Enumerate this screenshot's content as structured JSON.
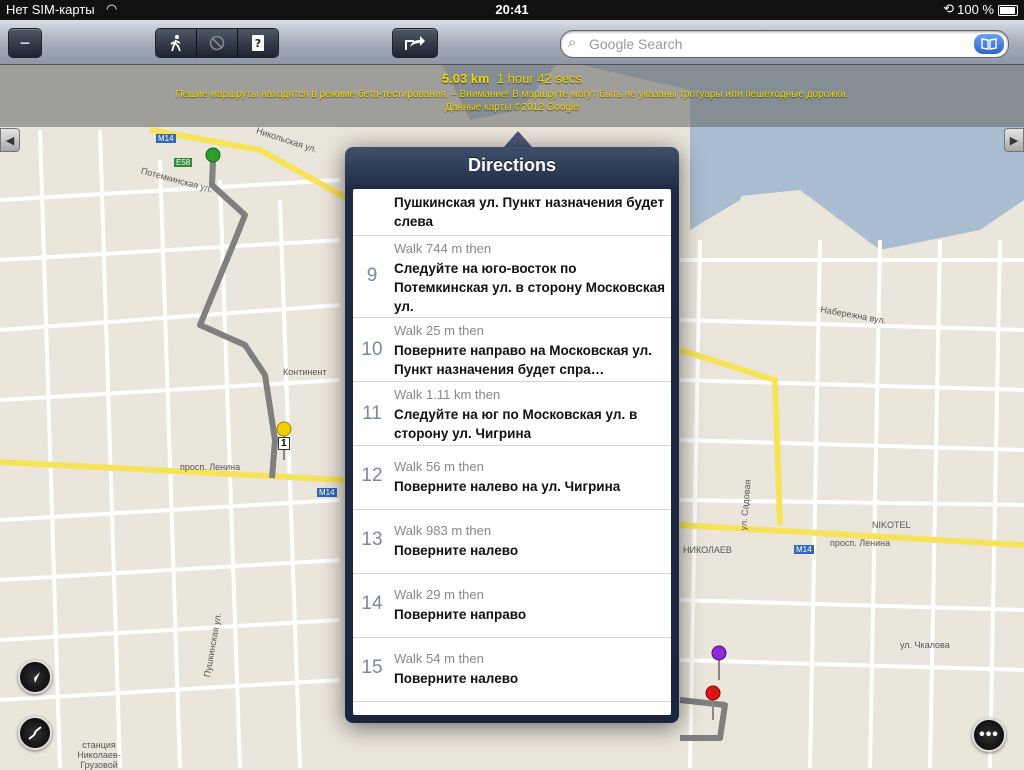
{
  "status_bar": {
    "carrier": "Нет SIM-карты",
    "time": "20:41",
    "battery": "100 %"
  },
  "toolbar": {
    "minus_label": "−",
    "search_placeholder": "Google Search",
    "icons": [
      "walk-icon",
      "no-entry-icon",
      "help-icon",
      "share-icon",
      "search-icon",
      "bookmarks-icon"
    ]
  },
  "route_info": {
    "distance": "5.03 km",
    "duration": "1 hour 42 secs",
    "warning": "Пешие маршруты находятся в режиме бета-тестирования. – Внимание! В маршруте могут быть не указаны тротуары или пешеходные дорожки.",
    "copyright": "Данные карты ©2012 Google"
  },
  "popover": {
    "title": "Directions",
    "partial_top": {
      "text": "Пушкинская ул. Пункт назначения будет слева"
    },
    "steps": [
      {
        "num": "9",
        "dist": "Walk 744 m then",
        "text": "Следуйте на юго-восток по Потемкинская ул. в сторону Московская ул."
      },
      {
        "num": "10",
        "dist": "Walk 25 m then",
        "text": "Поверните направо на Московская ул. Пункт назначения будет спра…"
      },
      {
        "num": "11",
        "dist": "Walk 1.11 km then",
        "text": "Следуйте на юг по Московская ул. в сторону ул. Чигрина"
      },
      {
        "num": "12",
        "dist": "Walk 56 m then",
        "text": "Поверните налево на ул. Чигрина"
      },
      {
        "num": "13",
        "dist": "Walk 983 m then",
        "text": "Поверните налево"
      },
      {
        "num": "14",
        "dist": "Walk 29 m then",
        "text": "Поверните направо"
      },
      {
        "num": "15",
        "dist": "Walk 54 m then",
        "text": "Поверните налево"
      }
    ]
  },
  "map_labels": {
    "m14_a": "M14",
    "m14_b": "M14",
    "m14_c": "M14",
    "e58": "E58",
    "nikolskaya": "Никольская ул.",
    "potemkinskaya": "Потемкинская ул.",
    "pushkinskaya": "Пушкинская ул.",
    "lenina_left": "просп. Ленина",
    "lenina_right": "просп. Ленина",
    "sadovaya": "ул. Садовая",
    "naberezhnaya": "Набережна вул.",
    "chkalova": "ул. Чкалова",
    "kontinent": "Континент",
    "nikotel": "NIKOTEL",
    "nikolaev": "НИКОЛАЕВ",
    "station": "станция Николаев-Грузовой",
    "marker_1": "1"
  }
}
